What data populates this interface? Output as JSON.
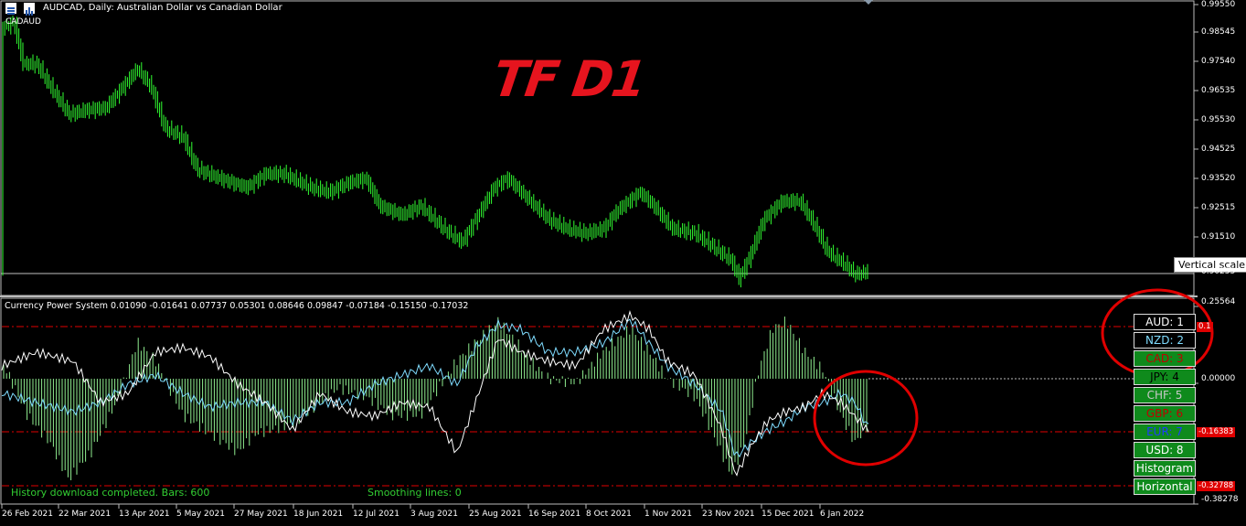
{
  "header": {
    "symbol_line": "AUDCAD, Daily:  Australian Dollar vs Canadian Dollar",
    "subtitle": "CADAUD",
    "icons": [
      "list-icon",
      "chart-icon"
    ]
  },
  "overlay": {
    "tf_label": "TF D1",
    "tooltip": "Vertical scale"
  },
  "price_axis": {
    "labels": [
      "0.99550",
      "0.98545",
      "0.97540",
      "0.96535",
      "0.95530",
      "0.94525",
      "0.93520",
      "0.92515",
      "0.91510",
      "0.90255"
    ]
  },
  "indicator": {
    "title": "Currency Power System 0.01090 -0.01641 0.07737 0.05301 0.08646 0.09847 -0.07184 -0.15150 -0.17032",
    "axis_labels": [
      "0.25564",
      "0.00000",
      "-0.38278"
    ],
    "level_tags": [
      "0.1",
      "-0.16383",
      "-0.32788"
    ],
    "status_left": "History download completed. Bars: 600",
    "status_right": "Smoothing lines: 0"
  },
  "ranking_panel": [
    {
      "label": "AUD: 1",
      "color": "#ffffff",
      "bg": "#000000"
    },
    {
      "label": "NZD: 2",
      "color": "#7fdcff",
      "bg": "#000000"
    },
    {
      "label": "CAD: 3",
      "color": "#c00000",
      "bg": "#0f8a1c"
    },
    {
      "label": "JPY: 4",
      "color": "#000000",
      "bg": "#0f8a1c"
    },
    {
      "label": "CHF: 5",
      "color": "#c8c8c8",
      "bg": "#0f8a1c"
    },
    {
      "label": "GBP: 6",
      "color": "#c00000",
      "bg": "#0f8a1c"
    },
    {
      "label": "EUR: 7",
      "color": "#1e3cff",
      "bg": "#0f8a1c"
    },
    {
      "label": "USD: 8",
      "color": "#ffffff",
      "bg": "#0f8a1c"
    },
    {
      "label": "Histogram",
      "color": "#ffffff",
      "bg": "#0f8a1c"
    },
    {
      "label": "Horizontal",
      "color": "#ffffff",
      "bg": "#0f8a1c"
    }
  ],
  "date_axis": {
    "labels": [
      "26 Feb 2021",
      "22 Mar 2021",
      "13 Apr 2021",
      "5 May 2021",
      "27 May 2021",
      "18 Jun 2021",
      "12 Jul 2021",
      "3 Aug 2021",
      "25 Aug 2021",
      "16 Sep 2021",
      "8 Oct 2021",
      "1 Nov 2021",
      "23 Nov 2021",
      "15 Dec 2021",
      "6 Jan 2022"
    ]
  },
  "colors": {
    "bull_candle": "#32ff32",
    "histogram": "#90ee90",
    "line_aud": "#ffffff",
    "line_nzd": "#7fdcff",
    "level_line": "#e00000",
    "highlight_circle": "#e00000"
  }
}
